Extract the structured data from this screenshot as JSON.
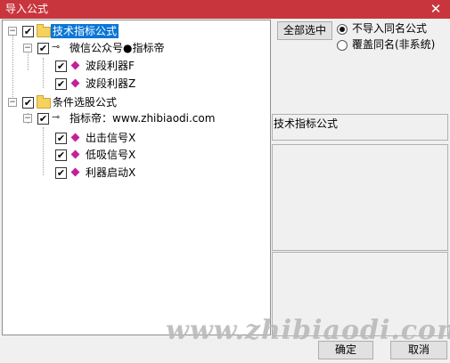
{
  "window": {
    "title": "导入公式",
    "close_glyph": "✕"
  },
  "tree": {
    "nodes": [
      {
        "label": "技术指标公式",
        "checked": true,
        "selected": true
      },
      {
        "label": "微信公众号●指标帝",
        "checked": true
      },
      {
        "label": "波段利器F",
        "checked": true
      },
      {
        "label": "波段利器Z",
        "checked": true
      },
      {
        "label": "条件选股公式",
        "checked": true
      },
      {
        "label": "指标帝：www.zhibiaodi.com",
        "checked": true
      },
      {
        "label": "出击信号X",
        "checked": true
      },
      {
        "label": "低吸信号X",
        "checked": true
      },
      {
        "label": "利器启动X",
        "checked": true
      }
    ],
    "expander_glyph": "−",
    "check_glyph": "✔",
    "key_glyph": "⊸"
  },
  "options": {
    "select_all_label": "全部选中",
    "radio": [
      {
        "label": "不导入同名公式",
        "selected": true
      },
      {
        "label": "覆盖同名(非系统)",
        "selected": false
      }
    ]
  },
  "info": {
    "formula_type": "技术指标公式"
  },
  "footer": {
    "ok_label": "确定",
    "cancel_label": "取消"
  },
  "watermark": "www.zhibiaodi.com",
  "colors": {
    "titlebar": "#c9353c",
    "selection": "#0b76d6",
    "icon_diamond": "#c2219c",
    "folder": "#f5d25e"
  }
}
